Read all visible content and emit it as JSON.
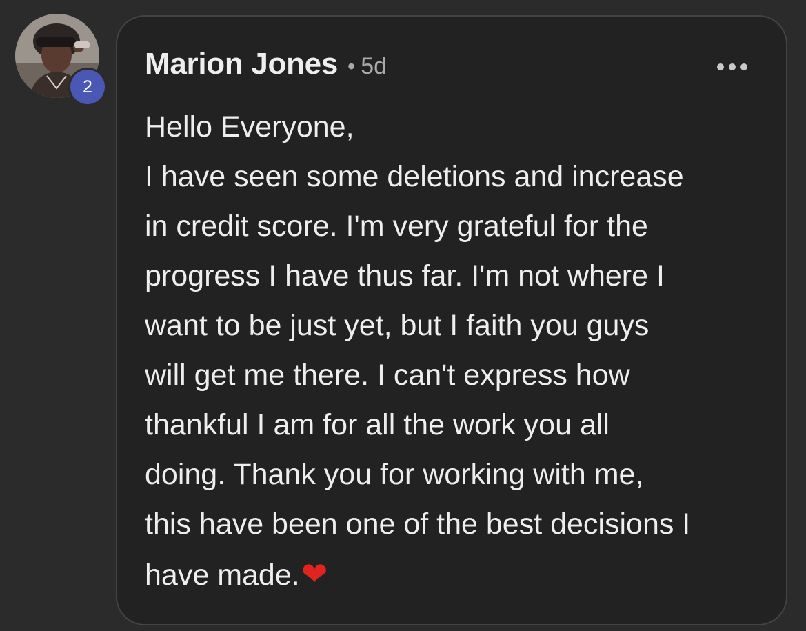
{
  "post": {
    "author": "Marion Jones",
    "separator": "•",
    "time": "5d",
    "badge_count": "2",
    "avatar_icon": "profile-photo",
    "more_icon": "more-horizontal-icon",
    "body": "Hello Everyone,\nI have seen some deletions and increase\nin credit score. I'm very grateful for the\nprogress I have thus far. I'm not where I\nwant to be just yet, but I faith you guys\nwill get me there. I can't express how\nthankful I am for all the work you all\ndoing. Thank you for working with me,\nthis have been one of the best decisions I\nhave made.",
    "heart": "❤",
    "colors": {
      "background": "#2b2b2b",
      "card": "#222222",
      "text": "#eeeeee",
      "muted": "#a9a9a9",
      "badge": "#4a57b4",
      "heart": "#e1241e"
    }
  }
}
